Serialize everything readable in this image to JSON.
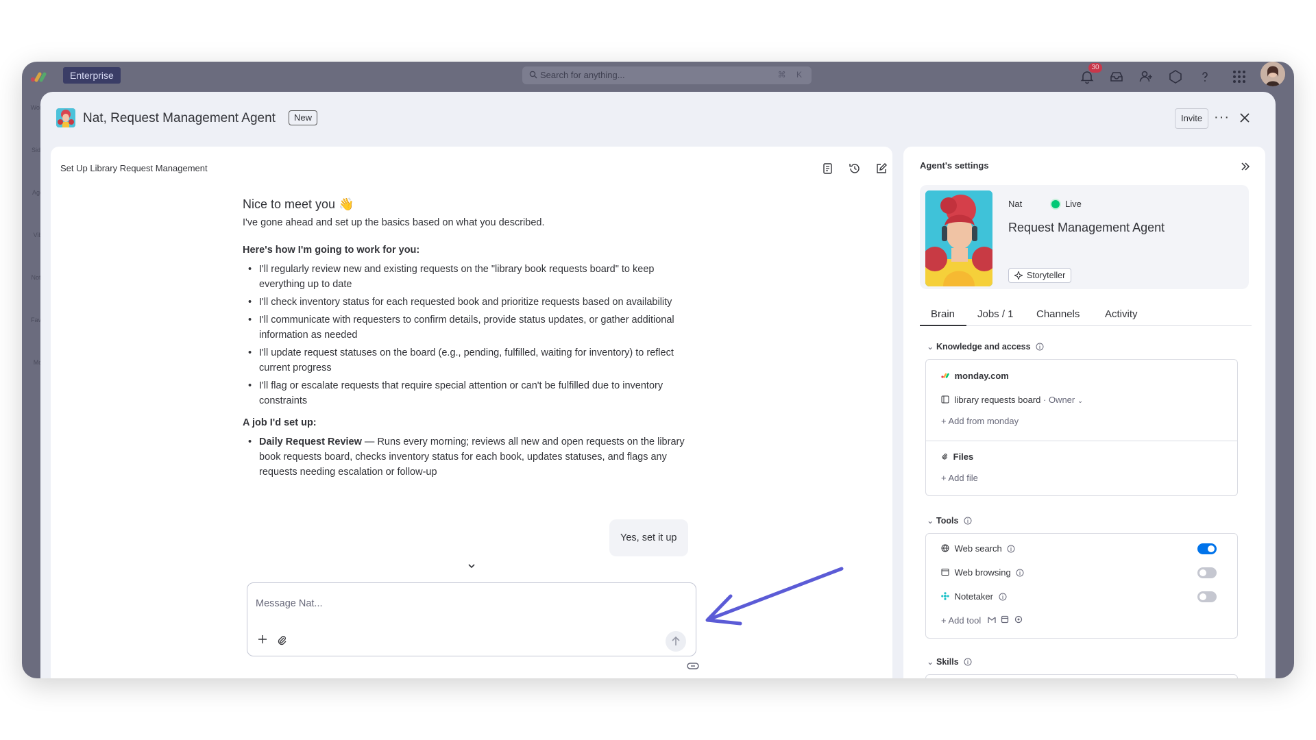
{
  "topbar": {
    "plan_badge": "Enterprise",
    "search_placeholder": "Search for anything...",
    "search_shortcut": "⌘ K",
    "notifications_count": "30",
    "icons": [
      "notifications-bell-icon",
      "inbox-icon",
      "invite-members-icon",
      "apps-marketplace-icon",
      "help-icon",
      "apps-grid-icon"
    ]
  },
  "left_strip": {
    "items": [
      {
        "label": "Work",
        "icon": "work-icon"
      },
      {
        "label": "Side",
        "icon": "sidekick-icon"
      },
      {
        "label": "Age",
        "icon": "agents-icon"
      },
      {
        "label": "Vib",
        "icon": "vibe-icon"
      },
      {
        "label": "Note",
        "icon": "notetaker-icon"
      },
      {
        "label": "Favo",
        "icon": "favorites-icon"
      },
      {
        "label": "Mo",
        "icon": "more-icon"
      }
    ]
  },
  "modal": {
    "title": "Nat, Request Management Agent",
    "new_tag": "New",
    "invite_label": "Invite"
  },
  "chat": {
    "title": "Set Up Library Request Management",
    "greeting": "Nice to meet you 👋",
    "intro": "I've gone ahead and set up the basics based on what you described.",
    "how_heading": "Here's how I'm going to work for you:",
    "how_items": [
      "I'll regularly review new and existing requests on the \"library book requests board\" to keep everything up to date",
      "I'll check inventory status for each requested book and prioritize requests based on availability",
      "I'll communicate with requesters to confirm details, provide status updates, or gather additional information as needed",
      "I'll update request statuses on the board (e.g., pending, fulfilled, waiting for inventory) to reflect current progress",
      "I'll flag or escalate requests that require special attention or can't be fulfilled due to inventory constraints"
    ],
    "job_heading": "A job I'd set up:",
    "job_name": "Daily Request Review",
    "job_desc": " — Runs every morning; reviews all new and open requests on the library book requests board, checks inventory status for each book, updates statuses, and flags any requests needing escalation or follow-up",
    "user_reply": "Yes, set it up",
    "composer_placeholder": "Message Nat..."
  },
  "settings": {
    "title": "Agent's settings",
    "agent_name": "Nat",
    "status": "Live",
    "role": "Request Management Agent",
    "persona_tag": "Storyteller",
    "tabs": [
      "Brain",
      "Jobs / 1",
      "Channels",
      "Activity"
    ],
    "knowledge": {
      "heading": "Knowledge and access",
      "source": "monday.com",
      "board": "library requests board",
      "board_role": "Owner",
      "add_monday": "Add from monday",
      "files_label": "Files",
      "add_file": "Add file"
    },
    "tools": {
      "heading": "Tools",
      "items": [
        {
          "label": "Web search",
          "enabled": true,
          "icon": "web-search-icon"
        },
        {
          "label": "Web browsing",
          "enabled": false,
          "icon": "web-browsing-icon"
        },
        {
          "label": "Notetaker",
          "enabled": false,
          "icon": "notetaker-icon"
        }
      ],
      "add_tool": "Add tool"
    },
    "skills_heading": "Skills"
  },
  "colors": {
    "accent": "#0073ea",
    "live_green": "#00c875",
    "annotation_arrow": "#5b5bd6",
    "frame": "#6b6c7e",
    "modal_bg": "#eef0f6"
  }
}
